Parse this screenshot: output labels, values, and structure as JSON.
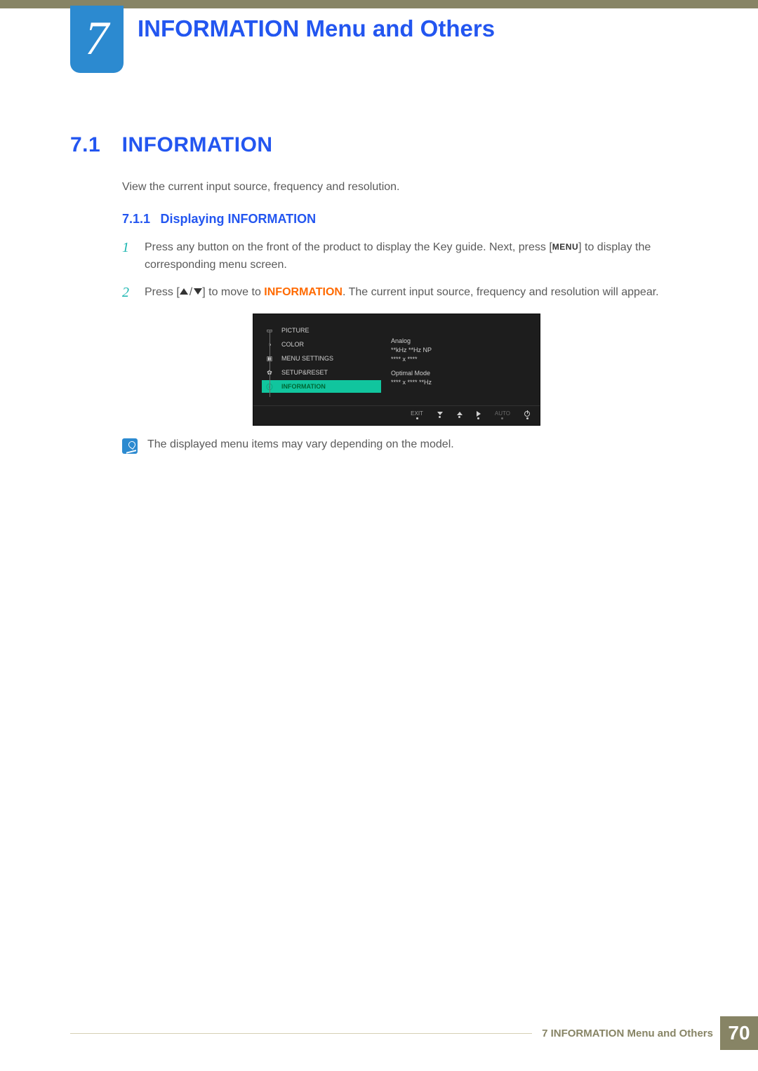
{
  "chapter": {
    "number": "7",
    "title": "INFORMATION Menu and Others"
  },
  "section": {
    "number": "7.1",
    "title": "INFORMATION",
    "intro": "View the current input source, frequency and resolution."
  },
  "subsection": {
    "number": "7.1.1",
    "title": "Displaying INFORMATION"
  },
  "steps": {
    "s1": {
      "num": "1",
      "before_key": "Press any button on the front of the product to display the Key guide. Next, press [",
      "key": "MENU",
      "after_key": "] to display the corresponding menu screen."
    },
    "s2": {
      "num": "2",
      "before_arrows": "Press [",
      "after_arrows_before_kw": "] to move to ",
      "keyword": "INFORMATION",
      "after_kw": ". The current input source, frequency and resolution will appear."
    }
  },
  "osd": {
    "menu": {
      "picture": "PICTURE",
      "color": "COLOR",
      "menu_settings": "MENU SETTINGS",
      "setup_reset": "SETUP&RESET",
      "information": "INFORMATION"
    },
    "info": {
      "line1": "Analog",
      "line2": "**kHz **Hz NP",
      "line3": "**** x ****",
      "line4": "Optimal Mode",
      "line5": "**** x **** **Hz"
    },
    "footer": {
      "exit": "EXIT",
      "auto": "AUTO"
    }
  },
  "note": "The displayed menu items may vary depending on the model.",
  "footer": {
    "label": "7 INFORMATION Menu and Others",
    "page": "70"
  }
}
